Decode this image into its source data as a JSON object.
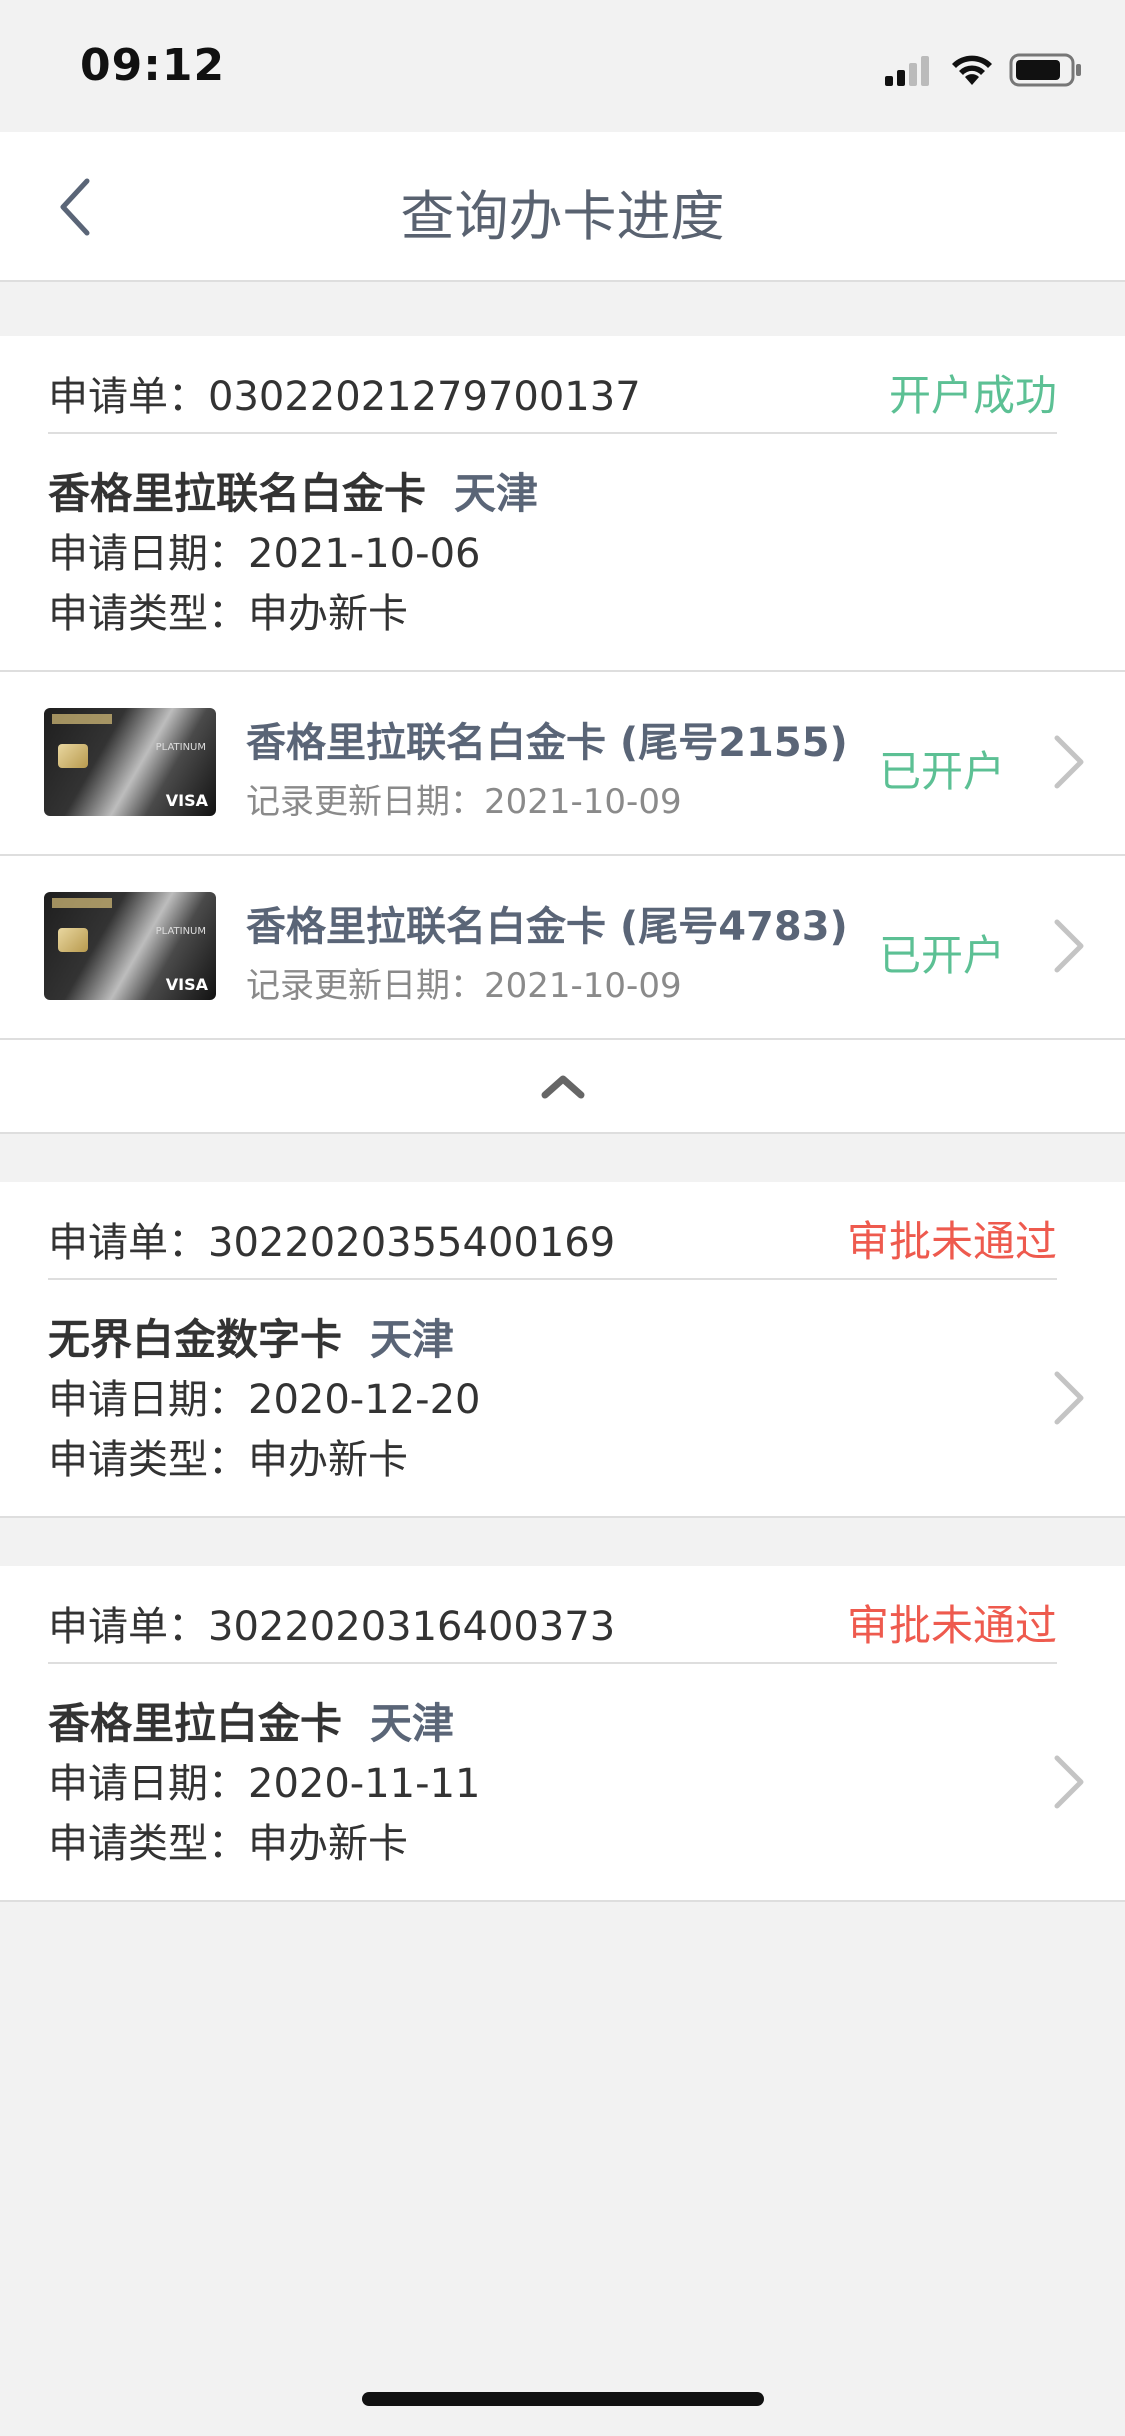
{
  "status_bar": {
    "time": "09:12"
  },
  "nav": {
    "title": "查询办卡进度"
  },
  "labels": {
    "app_no_prefix": "申请单：",
    "date_prefix": "申请日期：",
    "type_prefix": "申请类型：",
    "update_prefix": "记录更新日期："
  },
  "applications": [
    {
      "app_no": "03022021279700137",
      "status": "开户成功",
      "card_name": "香格里拉联名白金卡",
      "city": "天津",
      "apply_date": "2021-10-06",
      "apply_type": "申办新卡",
      "cards": [
        {
          "title": "香格里拉联名白金卡 (尾号2155)",
          "update_date": "2021-10-09",
          "status": "已开户"
        },
        {
          "title": "香格里拉联名白金卡 (尾号4783)",
          "update_date": "2021-10-09",
          "status": "已开户"
        }
      ]
    },
    {
      "app_no": "3022020355400169",
      "status": "审批未通过",
      "card_name": "无界白金数字卡",
      "city": "天津",
      "apply_date": "2020-12-20",
      "apply_type": "申办新卡"
    },
    {
      "app_no": "3022020316400373",
      "status": "审批未通过",
      "card_name": "香格里拉白金卡",
      "city": "天津",
      "apply_date": "2020-11-11",
      "apply_type": "申办新卡"
    }
  ],
  "colors": {
    "success": "#5cc094",
    "fail": "#ee5a4e",
    "title": "#596270"
  }
}
